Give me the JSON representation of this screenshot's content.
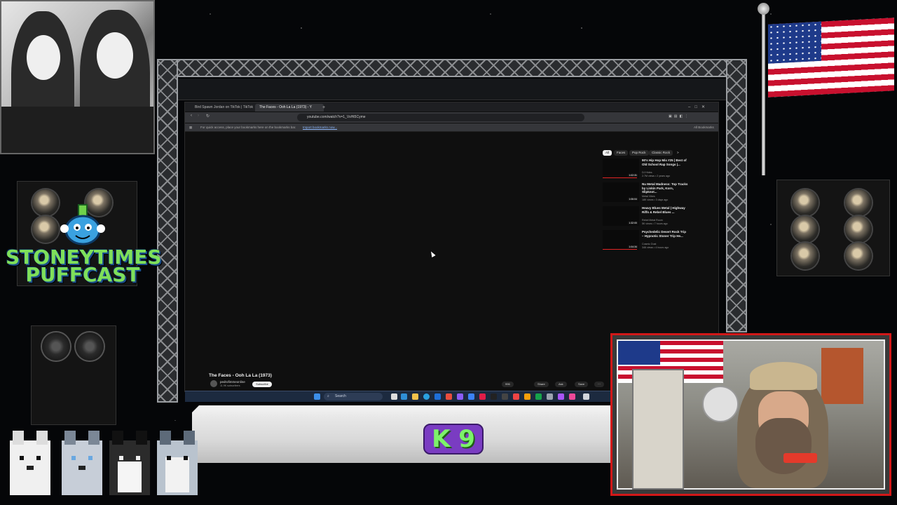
{
  "overlay": {
    "logo_line1": "STONEYTIMES",
    "logo_line2": "PUFFCAST",
    "badge": "K 9"
  },
  "browser": {
    "tabs": [
      {
        "label": "Bird Spawn Jordan on TikTok | TikTok",
        "active": false
      },
      {
        "label": "The Faces - Ooh La La (1973) - Y",
        "active": true
      }
    ],
    "new_tab": "+",
    "url": "youtube.com/watch?v=1_VsHt5Cyme",
    "bookmark_hint": "For quick access, place your bookmarks here on the bookmarks bar.",
    "bookmark_link": "Import bookmarks now...",
    "all_bookmarks": "All Bookmarks"
  },
  "youtube": {
    "chips": [
      "All",
      "Faces",
      "Pop Rock",
      "Classic Rock",
      ">"
    ],
    "video_title": "The Faces - Ooh La La (1973)",
    "channel": "pedrofimmeonline",
    "subscribers": "11.9K subscribers",
    "subscribe_label": "Subscribe",
    "actions": [
      "996",
      "Share",
      "Ask",
      "Save"
    ],
    "recommendations": [
      {
        "title": "90's Hip Hop Mix #25 | Best of Old School Rap Songs |...",
        "meta": "DJ Hides\n2.7M views • 2 years ago",
        "duration": "1:02:31",
        "progress": 0.95
      },
      {
        "title": "Nu Metal Madness: Top Tracks by Linkin Park, Korn, Slipknot...",
        "meta": "Metal Vibes\n18K views • 3 days ago",
        "duration": "1:06:04",
        "progress": 0
      },
      {
        "title": "Heavy Blues Metal | Highway Riffs & Rebel Blues ...",
        "meta": "Rebel Metal Room\n5K views • 7 hours ago",
        "duration": "1:32:00",
        "progress": 0
      },
      {
        "title": "Psychedelic Desert Rock Trip – Hypnotic Stoner Trip He...",
        "meta": "Cosmic Dust\n346 views • 4 hours ago",
        "duration": "1:04:34",
        "progress": 0.95
      }
    ]
  },
  "taskbar": {
    "search_placeholder": "Search"
  },
  "colors": {
    "accent_red": "#c8102e",
    "logo_green": "#7fe05a",
    "badge_purple": "#7a3cc2",
    "cam_border": "#d21818"
  }
}
